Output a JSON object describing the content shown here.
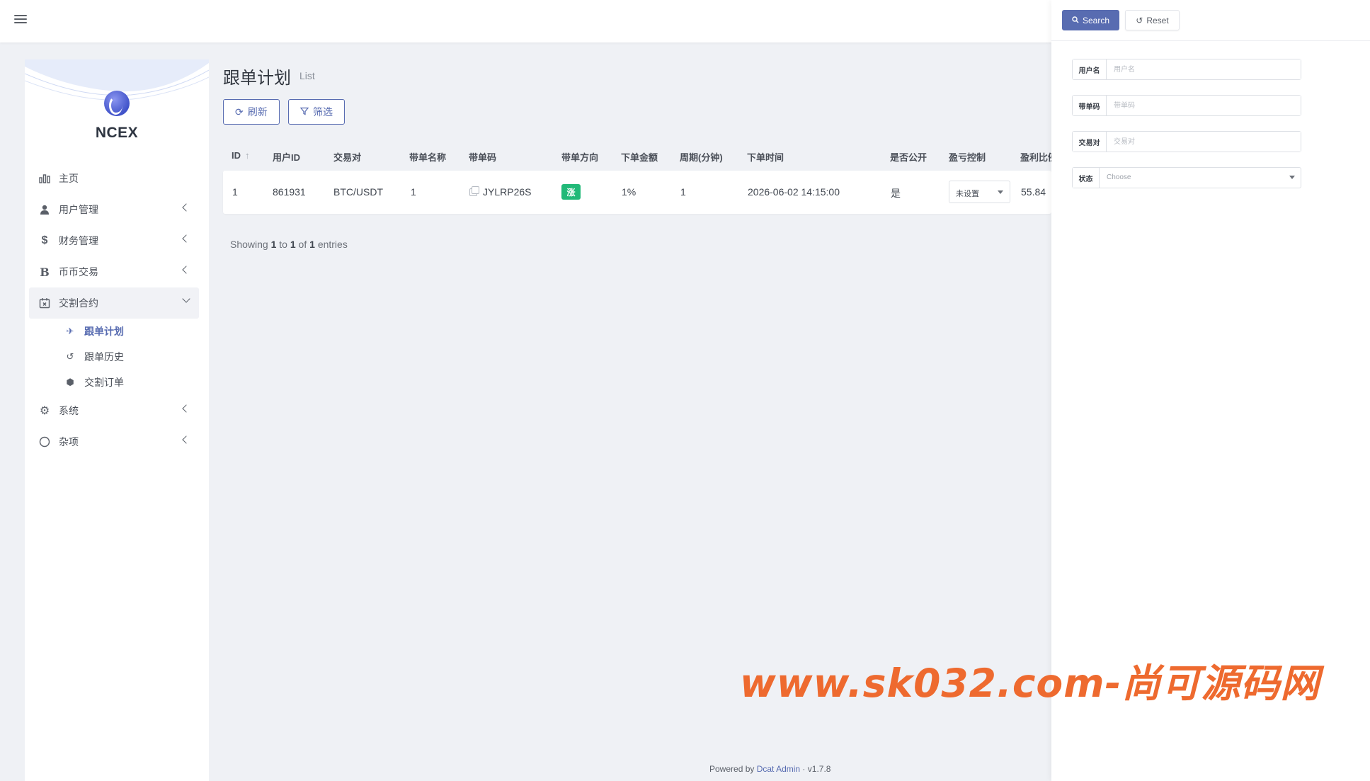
{
  "sidebar": {
    "brand": "NCEX",
    "menu": [
      {
        "label": "主页",
        "icon": "bar-chart-icon"
      },
      {
        "label": "用户管理",
        "icon": "users-icon"
      },
      {
        "label": "财务管理",
        "icon": "dollar-icon"
      },
      {
        "label": "币币交易",
        "icon": "bitcoin-icon"
      },
      {
        "label": "交割合约",
        "icon": "calendar-x-icon"
      },
      {
        "label": "系统",
        "icon": "gear-icon"
      },
      {
        "label": "杂项",
        "icon": "circle-icon"
      }
    ],
    "submenu": [
      {
        "label": "跟单计划",
        "icon": "plane-icon"
      },
      {
        "label": "跟单历史",
        "icon": "history-icon"
      },
      {
        "label": "交割订单",
        "icon": "cube-icon"
      }
    ]
  },
  "page": {
    "title": "跟单计划",
    "subtitle": "List",
    "refresh_label": "刷新",
    "filter_label": "筛选"
  },
  "table": {
    "headers": [
      "ID",
      "用户ID",
      "交易对",
      "带单名称",
      "带单码",
      "带单方向",
      "下单金额",
      "周期(分钟)",
      "下单时间",
      "是否公开",
      "盈亏控制",
      "盈利比例"
    ],
    "rows": [
      {
        "id": "1",
        "user_id": "861931",
        "pair": "BTC/USDT",
        "name": "1",
        "code": "JYLRP26S",
        "direction": "涨",
        "amount": "1%",
        "period": "1",
        "time": "2026-06-02 14:15:00",
        "public": "是",
        "control": "未设置",
        "profit": "55.84"
      }
    ],
    "showing": {
      "prefix": "Showing",
      "from": "1",
      "to_word": "to",
      "to": "1",
      "of_word": "of",
      "total": "1",
      "suffix": "entries"
    }
  },
  "filter": {
    "search_label": "Search",
    "reset_label": "Reset",
    "fields": [
      {
        "label": "用户名",
        "placeholder": "用户名"
      },
      {
        "label": "带单码",
        "placeholder": "带单码"
      },
      {
        "label": "交易对",
        "placeholder": "交易对"
      }
    ],
    "status": {
      "label": "状态",
      "placeholder": "Choose"
    }
  },
  "watermark": "www.sk032.com-尚可源码网",
  "footer": {
    "powered": "Powered by",
    "link": "Dcat Admin",
    "sep": "·",
    "version": "v1.7.8"
  },
  "colors": {
    "primary": "#586cb1",
    "success": "#21b978",
    "watermark": "#ee6a2f",
    "background": "#eff1f5"
  }
}
